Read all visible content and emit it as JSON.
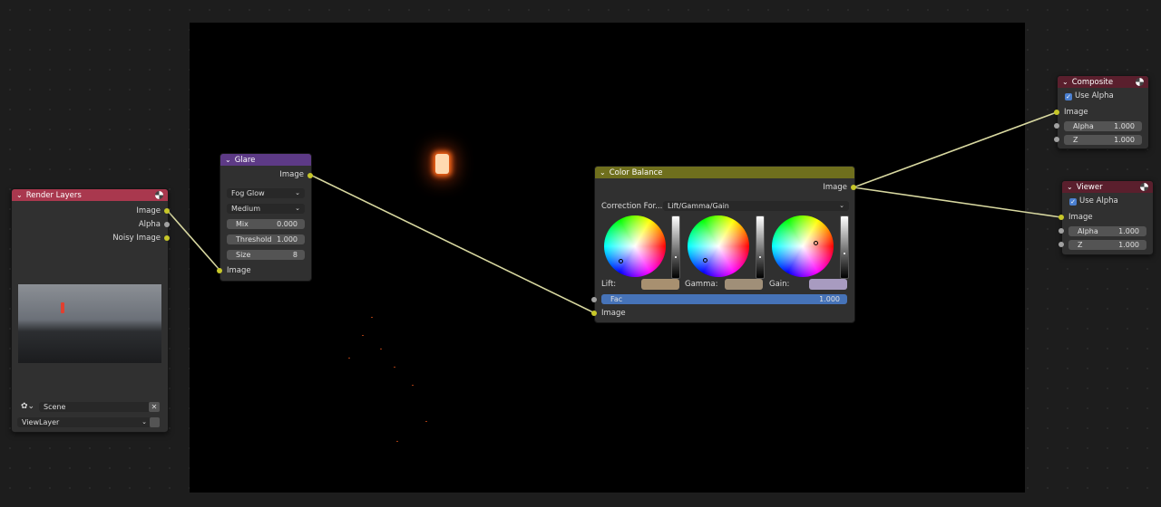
{
  "render_layers": {
    "title": "Render Layers",
    "outputs": [
      "Image",
      "Alpha",
      "Noisy Image"
    ],
    "input_socket_label": "Image",
    "scene_value": "Scene",
    "view_layer_value": "ViewLayer"
  },
  "glare": {
    "title": "Glare",
    "output_label": "Image",
    "glare_type": "Fog Glow",
    "quality": "Medium",
    "mix_label": "Mix",
    "mix_value": "0.000",
    "threshold_label": "Threshold",
    "threshold_value": "1.000",
    "size_label": "Size",
    "size_value": "8",
    "input_label": "Image"
  },
  "color_balance": {
    "title": "Color Balance",
    "output_label": "Image",
    "correction_label": "Correction For...",
    "correction_value": "Lift/Gamma/Gain",
    "lift_label": "Lift:",
    "gamma_label": "Gamma:",
    "gain_label": "Gain:",
    "lift_color": "#a89070",
    "gamma_color": "#a08f78",
    "gain_color": "#a89bc0",
    "fac_label": "Fac",
    "fac_value": "1.000",
    "input_label": "Image"
  },
  "composite": {
    "title": "Composite",
    "use_alpha_label": "Use Alpha",
    "image_label": "Image",
    "alpha_label": "Alpha",
    "alpha_value": "1.000",
    "z_label": "Z",
    "z_value": "1.000"
  },
  "viewer": {
    "title": "Viewer",
    "use_alpha_label": "Use Alpha",
    "image_label": "Image",
    "alpha_label": "Alpha",
    "alpha_value": "1.000",
    "z_label": "Z",
    "z_value": "1.000"
  },
  "colors": {
    "input_header": "#a9384e",
    "filter_header": "#5d3a86",
    "color_header": "#6f6f1d",
    "output_header": "#5a1f2d",
    "socket_color": "#c7c729",
    "socket_gray": "#a1a1a1",
    "fac_bar": "#4673b8"
  }
}
